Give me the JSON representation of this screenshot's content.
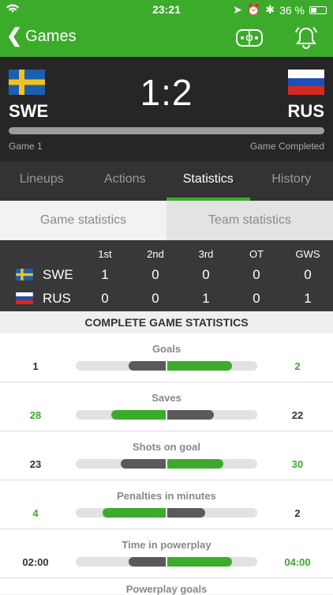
{
  "status": {
    "time": "23:21",
    "battery": "36 %"
  },
  "nav": {
    "back_label": "Games",
    "back_icon": "chevron-left-icon",
    "rink_icon": "rink-icon",
    "bell_icon": "bell-icon"
  },
  "game": {
    "home": {
      "code": "SWE",
      "flag": "sweden"
    },
    "away": {
      "code": "RUS",
      "flag": "russia"
    },
    "score": "1:2",
    "game_label": "Game 1",
    "status": "Game Completed"
  },
  "tabs": [
    "Lineups",
    "Actions",
    "Statistics",
    "History"
  ],
  "active_tab": "Statistics",
  "subtabs": [
    "Game statistics",
    "Team statistics"
  ],
  "active_subtab": "Game statistics",
  "periods": {
    "headers": [
      "1st",
      "2nd",
      "3rd",
      "OT",
      "GWS"
    ],
    "rows": [
      {
        "team": "SWE",
        "values": [
          "1",
          "0",
          "0",
          "0",
          "0"
        ]
      },
      {
        "team": "RUS",
        "values": [
          "0",
          "0",
          "1",
          "0",
          "1"
        ]
      }
    ]
  },
  "complete_title": "COMPLETE GAME STATISTICS",
  "colors": {
    "green": "#3cab2b",
    "dark_bar": "#5a5a5a"
  },
  "stats": [
    {
      "title": "Goals",
      "left": "1",
      "right": "2",
      "left_share": 0.42,
      "right_share": 0.72,
      "winner": "right"
    },
    {
      "title": "Saves",
      "left": "28",
      "right": "22",
      "left_share": 0.61,
      "right_share": 0.52,
      "winner": "left"
    },
    {
      "title": "Shots on goal",
      "left": "23",
      "right": "30",
      "left_share": 0.5,
      "right_share": 0.63,
      "winner": "right"
    },
    {
      "title": "Penalties in minutes",
      "left": "4",
      "right": "2",
      "left_share": 0.7,
      "right_share": 0.43,
      "winner": "left"
    },
    {
      "title": "Time in powerplay",
      "left": "02:00",
      "right": "04:00",
      "left_share": 0.42,
      "right_share": 0.72,
      "winner": "right"
    }
  ],
  "next_stat_title": "Powerplay goals"
}
